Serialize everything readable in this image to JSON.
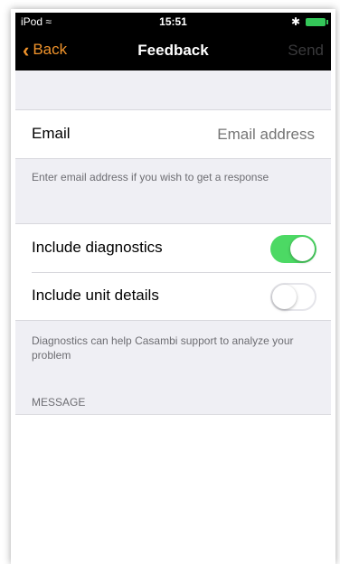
{
  "status": {
    "device": "iPod",
    "time": "15:51"
  },
  "nav": {
    "back_label": "Back",
    "title": "Feedback",
    "send_label": "Send"
  },
  "email": {
    "label": "Email",
    "placeholder": "Email address",
    "hint": "Enter email address if you wish to get a response"
  },
  "options": {
    "diagnostics_label": "Include diagnostics",
    "diagnostics_on": true,
    "unit_label": "Include unit details",
    "unit_on": false,
    "hint": "Diagnostics can help Casambi support to analyze your problem"
  },
  "message": {
    "header": "MESSAGE"
  },
  "colors": {
    "accent": "#f0932b",
    "toggle_on": "#4cd964"
  }
}
